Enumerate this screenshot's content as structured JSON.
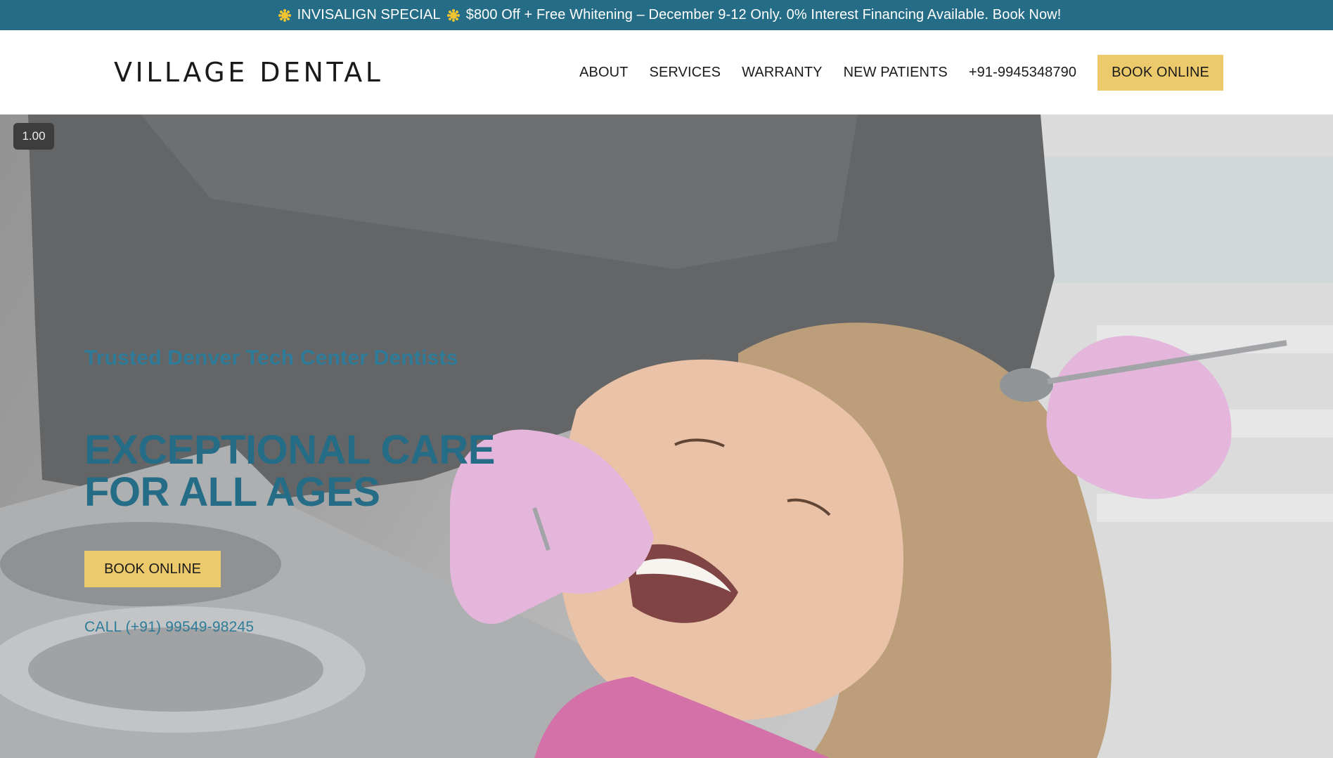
{
  "announcement": {
    "label": "INVISALIGN SPECIAL",
    "text": "$800 Off + Free Whitening – December 9-12 Only. 0% Interest Financing Available. Book Now!",
    "icon": "sun-icon"
  },
  "header": {
    "logo": "VILLAGE DENTAL",
    "nav": {
      "about": "ABOUT",
      "services": "SERVICES",
      "warranty": "WARRANTY",
      "new_patients": "NEW PATIENTS",
      "phone": "+91-9945348790",
      "book": "BOOK ONLINE"
    }
  },
  "hero": {
    "speed": "1.00",
    "subtitle": "Trusted Denver Tech Center Dentists",
    "title": "EXCEPTIONAL CARE FOR ALL AGES",
    "button": "BOOK ONLINE",
    "call": "CALL (+91) 99549-98245"
  },
  "colors": {
    "announcement_bg": "#256c86",
    "accent_button": "#ecc96a",
    "hero_text": "#256c86"
  }
}
